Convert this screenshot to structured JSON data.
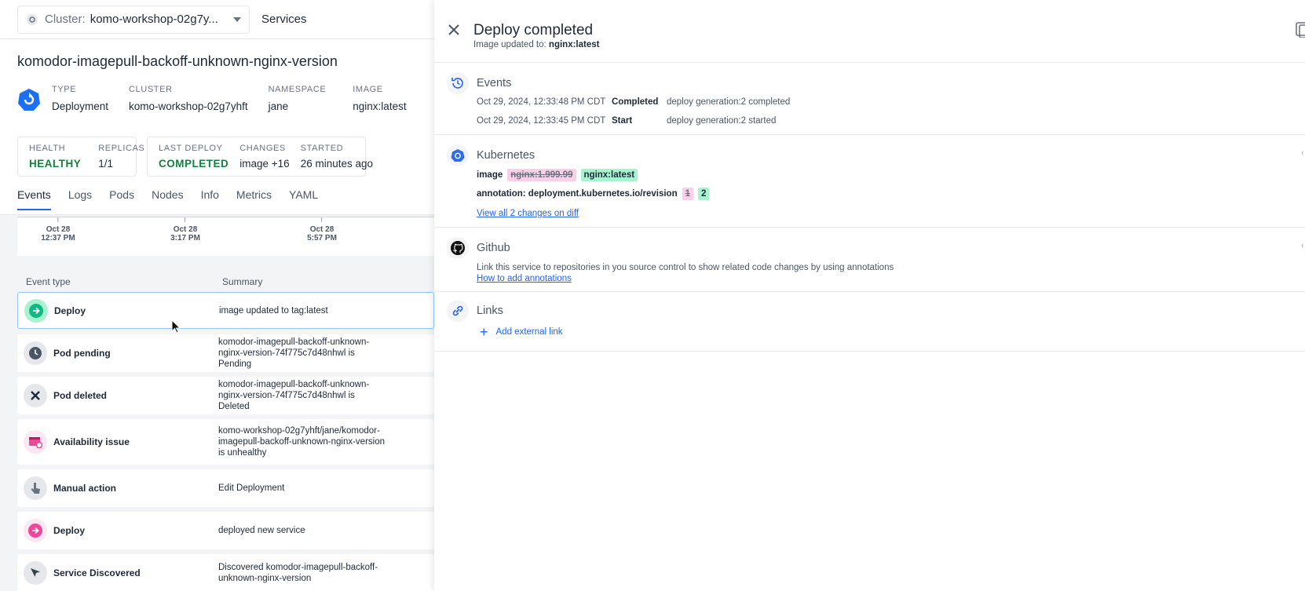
{
  "topbar": {
    "cluster_label": "Cluster:",
    "cluster_value": "komo-workshop-02g7y...",
    "services_link": "Services"
  },
  "service": {
    "title": "komodor-imagepull-backoff-unknown-nginx-version",
    "meta": [
      {
        "key": "TYPE",
        "value": "Deployment"
      },
      {
        "key": "CLUSTER",
        "value": "komo-workshop-02g7yhft"
      },
      {
        "key": "NAMESPACE",
        "value": "jane"
      },
      {
        "key": "IMAGE",
        "value": "nginx:latest"
      }
    ],
    "health_box": [
      {
        "key": "HEALTH",
        "value": "HEALTHY"
      },
      {
        "key": "REPLICAS",
        "value": "1/1"
      }
    ],
    "deploy_box": [
      {
        "key": "LAST DEPLOY",
        "value": "COMPLETED"
      },
      {
        "key": "CHANGES",
        "value": "image +16"
      },
      {
        "key": "STARTED",
        "value": "26 minutes ago"
      }
    ]
  },
  "tabs": [
    "Events",
    "Logs",
    "Pods",
    "Nodes",
    "Info",
    "Metrics",
    "YAML"
  ],
  "active_tab": "Events",
  "timeline": {
    "ticks": [
      {
        "date": "Oct 28",
        "time": "12:37 PM"
      },
      {
        "date": "Oct 28",
        "time": "3:17 PM"
      },
      {
        "date": "Oct 28",
        "time": "5:57 PM"
      }
    ]
  },
  "events_table": {
    "headers": {
      "type": "Event type",
      "summary": "Summary"
    },
    "rows": [
      {
        "type": "Deploy",
        "summary": "image updated to tag:latest",
        "icon": "arrow-right-icon",
        "color": "#34d399"
      },
      {
        "type": "Pod pending",
        "summary": "komodor-imagepull-backoff-unknown-nginx-version-74f775c7d48nhwl is Pending",
        "icon": "clock-icon",
        "color": "#4b5563"
      },
      {
        "type": "Pod deleted",
        "summary": "komodor-imagepull-backoff-unknown-nginx-version-74f775c7d48nhwl is Deleted",
        "icon": "x-icon",
        "color": "#4b5563"
      },
      {
        "type": "Availability issue",
        "summary": "komo-workshop-02g7yhft/jane/komodor-imagepull-backoff-unknown-nginx-version is unhealthy",
        "icon": "availability-icon",
        "color": "#ec4899"
      },
      {
        "type": "Manual action",
        "summary": "Edit Deployment",
        "icon": "hand-pointer-icon",
        "color": "#6b7280"
      },
      {
        "type": "Deploy",
        "summary": "deployed new service",
        "icon": "arrow-right-icon",
        "color": "#ec4899"
      },
      {
        "type": "Service Discovered",
        "summary": "Discovered komodor-imagepull-backoff-unknown-nginx-version",
        "icon": "cursor-icon",
        "color": "#4b5563"
      }
    ]
  },
  "drawer": {
    "title": "Deploy completed",
    "subtitle_prefix": "Image updated to:",
    "subtitle_value": "nginx:latest",
    "events": {
      "title": "Events",
      "items": [
        {
          "timestamp": "Oct 29, 2024, 12:33:48 PM CDT",
          "status": "Completed",
          "description": "deploy generation:2 completed"
        },
        {
          "timestamp": "Oct 29, 2024, 12:33:45 PM CDT",
          "status": "Start",
          "description": "deploy generation:2 started"
        }
      ]
    },
    "kubernetes": {
      "title": "Kubernetes",
      "image_label": "image",
      "image_old": "nginx:1.999.99",
      "image_new": "nginx:latest",
      "annotation_label": "annotation: deployment.kubernetes.io/revision",
      "annotation_old": "1",
      "annotation_new": "2",
      "diff_link": "View all 2 changes on diff"
    },
    "github": {
      "title": "Github",
      "text": "Link this service to repositories in you source control to show related code changes by using annotations",
      "link": "How to add annotations"
    },
    "links": {
      "title": "Links",
      "add_link": "Add external link"
    }
  },
  "colors": {
    "accent": "#2563eb",
    "healthy": "#15803d",
    "added": "#a7f3d0",
    "removed": "#fbcfe8"
  }
}
